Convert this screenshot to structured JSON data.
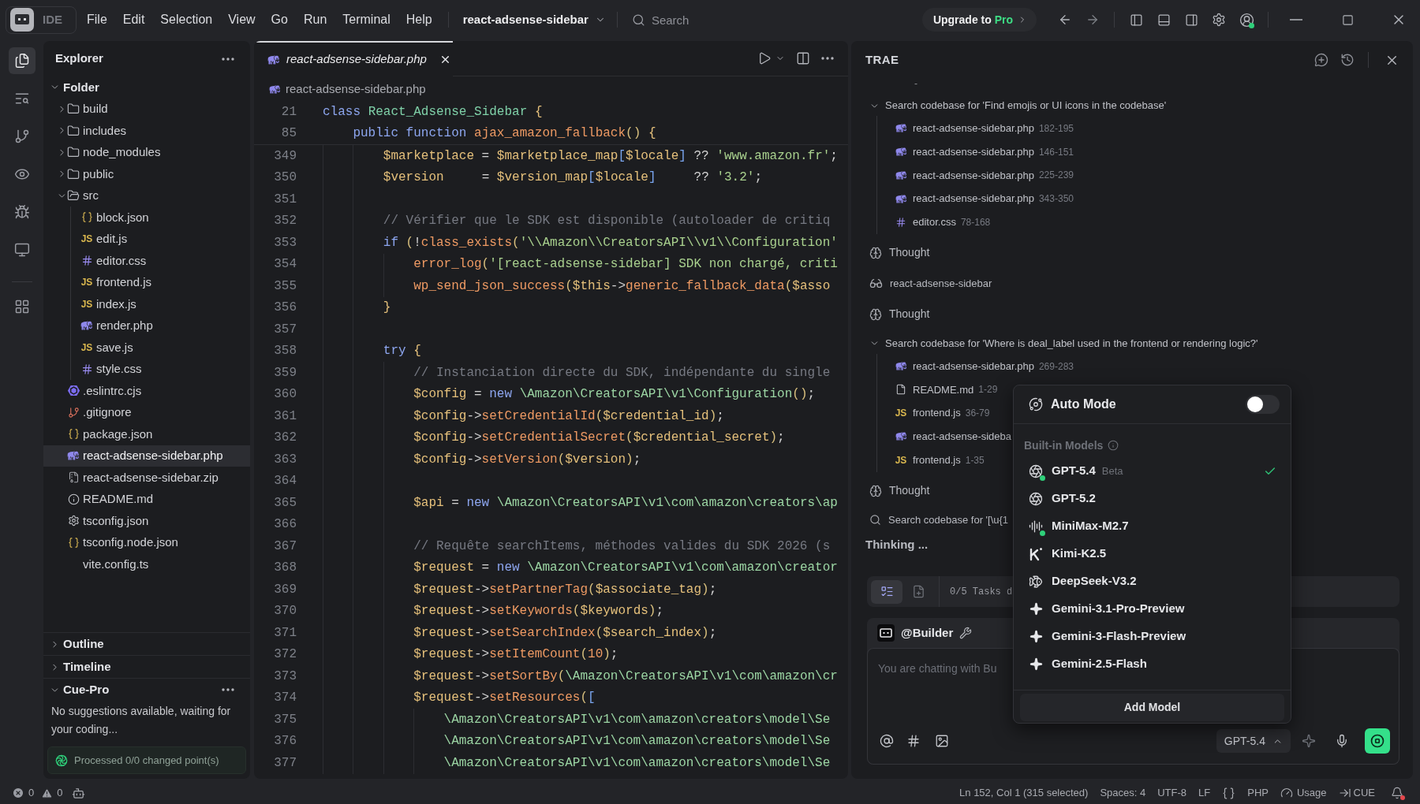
{
  "title_bar": {
    "app_label": "IDE",
    "menus": [
      "File",
      "Edit",
      "Selection",
      "View",
      "Go",
      "Run",
      "Terminal",
      "Help"
    ],
    "project": "react-adsense-sidebar",
    "search": {
      "placeholder": "Search"
    },
    "upgrade": {
      "label": "Upgrade to",
      "plan": "Pro"
    }
  },
  "activity_bar": {
    "items": [
      {
        "kind": "explorer",
        "selected": true
      },
      {
        "kind": "search",
        "selected": false
      },
      {
        "kind": "source_control",
        "selected": false
      },
      {
        "kind": "preview",
        "selected": false
      },
      {
        "kind": "debug",
        "selected": false
      },
      {
        "kind": "remote",
        "selected": false
      },
      {
        "kind": "extensions",
        "selected": false
      }
    ]
  },
  "explorer": {
    "title": "Explorer",
    "root": {
      "label": "Folder",
      "expanded": true,
      "children": [
        {
          "name": "build",
          "kind": "folder",
          "expanded": false,
          "selected": false
        },
        {
          "name": "includes",
          "kind": "folder",
          "expanded": false,
          "selected": false
        },
        {
          "name": "node_modules",
          "kind": "folder",
          "expanded": false,
          "selected": false
        },
        {
          "name": "public",
          "kind": "folder",
          "expanded": false,
          "selected": false
        },
        {
          "name": "src",
          "kind": "folder",
          "expanded": true,
          "selected": false,
          "children": [
            {
              "name": "block.json",
              "kind": "json",
              "selected": false
            },
            {
              "name": "edit.js",
              "kind": "js",
              "glyph": "JS",
              "selected": false
            },
            {
              "name": "editor.css",
              "kind": "css",
              "selected": false
            },
            {
              "name": "frontend.js",
              "kind": "js",
              "glyph": "JS",
              "selected": false
            },
            {
              "name": "index.js",
              "kind": "js",
              "glyph": "JS",
              "selected": false
            },
            {
              "name": "render.php",
              "kind": "php",
              "selected": false
            },
            {
              "name": "save.js",
              "kind": "js",
              "glyph": "JS",
              "selected": false
            },
            {
              "name": "style.css",
              "kind": "css",
              "selected": false
            }
          ]
        },
        {
          "name": ".eslintrc.cjs",
          "kind": "eslint",
          "selected": false
        },
        {
          "name": ".gitignore",
          "kind": "git",
          "selected": false
        },
        {
          "name": "package.json",
          "kind": "json",
          "selected": false
        },
        {
          "name": "react-adsense-sidebar.php",
          "kind": "php",
          "selected": true
        },
        {
          "name": "react-adsense-sidebar.zip",
          "kind": "zip",
          "selected": false
        },
        {
          "name": "README.md",
          "kind": "readme",
          "selected": false
        },
        {
          "name": "tsconfig.json",
          "kind": "config",
          "selected": false
        },
        {
          "name": "tsconfig.node.json",
          "kind": "json",
          "selected": false
        },
        {
          "name": "vite.config.ts",
          "kind": "plain",
          "selected": false
        }
      ]
    },
    "sections": [
      {
        "title": "Outline",
        "expanded": false
      },
      {
        "title": "Timeline",
        "expanded": false
      },
      {
        "title": "Cue-Pro",
        "expanded": true,
        "message": "No suggestions available, waiting for your coding...",
        "status": "Processed 0/0 changed point(s)"
      }
    ]
  },
  "editor": {
    "tabs": [
      {
        "label": "react-adsense-sidebar.php",
        "kind": "php",
        "selected": true,
        "preview": true
      }
    ],
    "breadcrumb": [
      {
        "label": "react-adsense-sidebar.php",
        "kind": "php"
      }
    ],
    "sticky_lines": [
      {
        "number": "21",
        "code": "class React_Adsense_Sidebar {"
      },
      {
        "number": "85",
        "code": "    public function ajax_amazon_fallback() {"
      }
    ],
    "lines": [
      {
        "number": "349",
        "code": "        $marketplace = $marketplace_map[$locale] ?? 'www.amazon.fr';"
      },
      {
        "number": "350",
        "code": "        $version     = $version_map[$locale]     ?? '3.2';"
      },
      {
        "number": "351"
      },
      {
        "number": "352",
        "code": "        // Vérifier que le SDK est disponible (autoloader de critiq"
      },
      {
        "number": "353",
        "code": "        if (!class_exists('\\\\Amazon\\\\CreatorsAPI\\\\v1\\\\Configuration'"
      },
      {
        "number": "354",
        "code": "            error_log('[react-adsense-sidebar] SDK non chargé, criti"
      },
      {
        "number": "355",
        "code": "            wp_send_json_success($this->generic_fallback_data($asso"
      },
      {
        "number": "356",
        "code": "        }"
      },
      {
        "number": "357"
      },
      {
        "number": "358",
        "code": "        try {"
      },
      {
        "number": "359",
        "code": "            // Instanciation directe du SDK, indépendante du single"
      },
      {
        "number": "360",
        "code": "            $config = new \\Amazon\\CreatorsAPI\\v1\\Configuration();"
      },
      {
        "number": "361",
        "code": "            $config->setCredentialId($credential_id);"
      },
      {
        "number": "362",
        "code": "            $config->setCredentialSecret($credential_secret);"
      },
      {
        "number": "363",
        "code": "            $config->setVersion($version);"
      },
      {
        "number": "364"
      },
      {
        "number": "365",
        "code": "            $api = new \\Amazon\\CreatorsAPI\\v1\\com\\amazon\\creators\\ap"
      },
      {
        "number": "366"
      },
      {
        "number": "367",
        "code": "            // Requête searchItems, méthodes valides du SDK 2026 (s"
      },
      {
        "number": "368",
        "code": "            $request = new \\Amazon\\CreatorsAPI\\v1\\com\\amazon\\creator"
      },
      {
        "number": "369",
        "code": "            $request->setPartnerTag($associate_tag);"
      },
      {
        "number": "370",
        "code": "            $request->setKeywords($keywords);"
      },
      {
        "number": "371",
        "code": "            $request->setSearchIndex($search_index);"
      },
      {
        "number": "372",
        "code": "            $request->setItemCount(10);"
      },
      {
        "number": "373",
        "code": "            $request->setSortBy(\\Amazon\\CreatorsAPI\\v1\\com\\amazon\\cr"
      },
      {
        "number": "374",
        "code": "            $request->setResources(["
      },
      {
        "number": "375",
        "code": "                \\Amazon\\CreatorsAPI\\v1\\com\\amazon\\creators\\model\\Se"
      },
      {
        "number": "376",
        "code": "                \\Amazon\\CreatorsAPI\\v1\\com\\amazon\\creators\\model\\Se"
      },
      {
        "number": "377",
        "code": "                \\Amazon\\CreatorsAPI\\v1\\com\\amazon\\creators\\model\\Se"
      }
    ]
  },
  "assistant": {
    "title": "TRAE",
    "fragment": "-",
    "steps": [
      {
        "kind": "search",
        "label": "Search codebase for 'Find emojis or UI icons in the codebase'",
        "expanded": true,
        "results": [
          {
            "file": "react-adsense-sidebar.php",
            "kind": "php",
            "range": "182-195"
          },
          {
            "file": "react-adsense-sidebar.php",
            "kind": "php",
            "range": "146-151"
          },
          {
            "file": "react-adsense-sidebar.php",
            "kind": "php",
            "range": "225-239"
          },
          {
            "file": "react-adsense-sidebar.php",
            "kind": "php",
            "range": "343-350"
          },
          {
            "file": "editor.css",
            "kind": "css",
            "range": "78-168"
          }
        ]
      },
      {
        "kind": "thought",
        "label": "Thought"
      },
      {
        "kind": "view",
        "label": "react-adsense-sidebar"
      },
      {
        "kind": "thought",
        "label": "Thought"
      },
      {
        "kind": "search",
        "label": "Search codebase for 'Where is deal_label used in the frontend or rendering logic?'",
        "expanded": true,
        "results": [
          {
            "file": "react-adsense-sidebar.php",
            "kind": "php",
            "range": "269-283"
          },
          {
            "file": "README.md",
            "kind": "doc",
            "range": "1-29"
          },
          {
            "file": "frontend.js",
            "kind": "js",
            "glyph": "JS",
            "range": "36-79"
          },
          {
            "file": "react-adsense-sideba",
            "kind": "php"
          },
          {
            "file": "frontend.js",
            "kind": "js",
            "glyph": "JS",
            "range": "1-35"
          }
        ]
      },
      {
        "kind": "thought",
        "label": "Thought"
      },
      {
        "kind": "searching",
        "label": "Search codebase for '[\\u{1"
      }
    ],
    "status": "Thinking ...",
    "tasks": {
      "views": [
        {
          "kind": "checklist",
          "selected": true
        },
        {
          "kind": "document",
          "selected": false
        }
      ],
      "label": "0/5 Tasks d"
    },
    "chat": {
      "agent": "@Builder",
      "placeholder": "You are chatting with Bu",
      "model": "GPT-5.4"
    }
  },
  "model_menu": {
    "auto_mode": {
      "label": "Auto Mode",
      "on": false
    },
    "section": "Built-in Models",
    "models": [
      {
        "name": "GPT-5.4",
        "kind": "openai",
        "tag": "Beta",
        "indicator_dot": true,
        "selected": true
      },
      {
        "name": "GPT-5.2",
        "kind": "openai",
        "indicator_dot": false,
        "selected": false
      },
      {
        "name": "MiniMax-M2.7",
        "kind": "minimax",
        "indicator_dot": true,
        "selected": false
      },
      {
        "name": "Kimi-K2.5",
        "kind": "kimi",
        "indicator_dot": false,
        "selected": false
      },
      {
        "name": "DeepSeek-V3.2",
        "kind": "deepseek",
        "indicator_dot": false,
        "selected": false
      },
      {
        "name": "Gemini-3.1-Pro-Preview",
        "kind": "gemini",
        "indicator_dot": false,
        "selected": false
      },
      {
        "name": "Gemini-3-Flash-Preview",
        "kind": "gemini",
        "indicator_dot": false,
        "selected": false
      },
      {
        "name": "Gemini-2.5-Flash",
        "kind": "gemini",
        "indicator_dot": false,
        "selected": false
      }
    ],
    "add_button": "Add Model"
  },
  "status_bar": {
    "errors": "0",
    "warnings": "0",
    "items": [
      {
        "kind": "text",
        "label": "Ln 152, Col 1 (315 selected)"
      },
      {
        "kind": "text",
        "label": "Spaces: 4"
      },
      {
        "kind": "text",
        "label": "UTF-8"
      },
      {
        "kind": "text",
        "label": "LF"
      },
      {
        "kind": "braces"
      },
      {
        "kind": "text",
        "label": "PHP"
      },
      {
        "kind": "usage",
        "label": "Usage"
      },
      {
        "kind": "cue",
        "label": "CUE"
      }
    ],
    "notifications": {
      "unread": true
    }
  }
}
